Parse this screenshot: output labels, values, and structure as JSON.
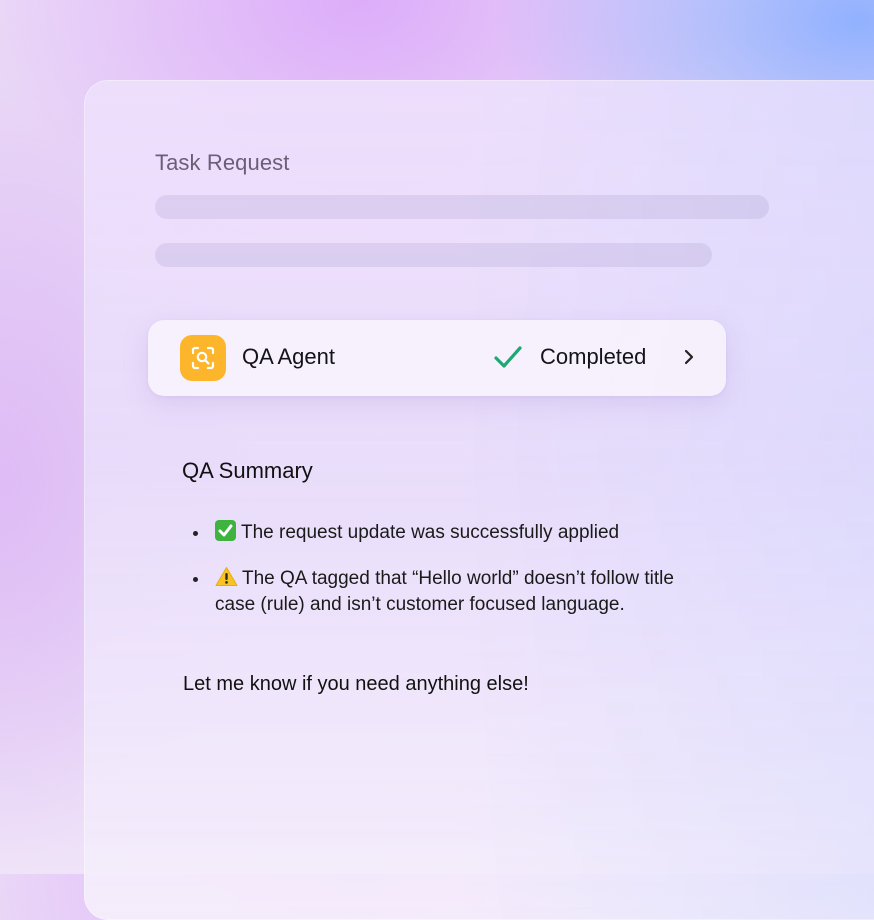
{
  "task": {
    "title": "Task Request"
  },
  "agent": {
    "name": "QA Agent",
    "icon": "qa-scan-icon",
    "status": "Completed",
    "status_icon": "check-icon",
    "accent_color": "#FDB52C",
    "status_color": "#1FA874"
  },
  "summary": {
    "title": "QA Summary",
    "items": [
      {
        "icon": "check-box-emoji",
        "text": "The request update was successfully applied"
      },
      {
        "icon": "warning-emoji",
        "text": "The QA tagged that “Hello world” doesn’t follow title case (rule) and isn’t customer focused language."
      }
    ],
    "closing": "Let me know if you need anything else!"
  }
}
